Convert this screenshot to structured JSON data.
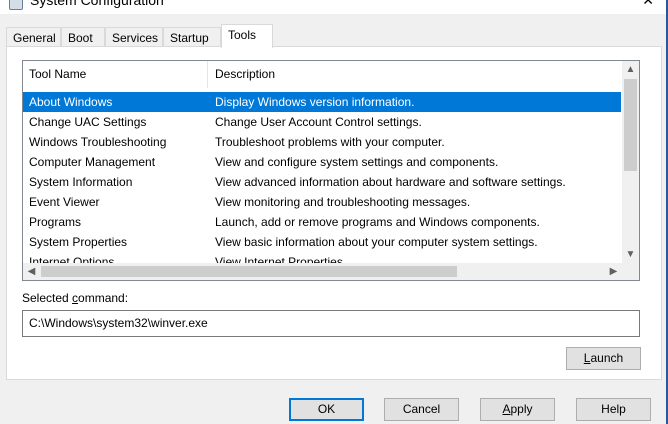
{
  "window": {
    "title": "System Configuration",
    "close_glyph": "✕"
  },
  "tabs": [
    {
      "label": "General"
    },
    {
      "label": "Boot"
    },
    {
      "label": "Services"
    },
    {
      "label": "Startup"
    },
    {
      "label": "Tools",
      "active": true
    }
  ],
  "list": {
    "columns": [
      "Tool Name",
      "Description"
    ],
    "rows": [
      {
        "name": "About Windows",
        "desc": "Display Windows version information.",
        "selected": true
      },
      {
        "name": "Change UAC Settings",
        "desc": "Change User Account Control settings."
      },
      {
        "name": "Windows Troubleshooting",
        "desc": "Troubleshoot problems with your computer."
      },
      {
        "name": "Computer Management",
        "desc": "View and configure system settings and components."
      },
      {
        "name": "System Information",
        "desc": "View advanced information about hardware and software settings."
      },
      {
        "name": "Event Viewer",
        "desc": "View monitoring and troubleshooting messages."
      },
      {
        "name": "Programs",
        "desc": "Launch, add or remove programs and Windows components."
      },
      {
        "name": "System Properties",
        "desc": "View basic information about your computer system settings."
      },
      {
        "name": "Internet Options",
        "desc": "View Internet Properties."
      }
    ]
  },
  "selected_command": {
    "label_prefix": "Selected ",
    "label_accel": "c",
    "label_suffix": "ommand:",
    "value": "C:\\Windows\\system32\\winver.exe"
  },
  "buttons": {
    "launch_accel": "L",
    "launch_rest": "aunch",
    "ok": "OK",
    "cancel": "Cancel",
    "apply_accel": "A",
    "apply_rest": "pply",
    "help": "Help"
  },
  "colors": {
    "selection": "#0078d7",
    "background": "#f0f0f0"
  }
}
